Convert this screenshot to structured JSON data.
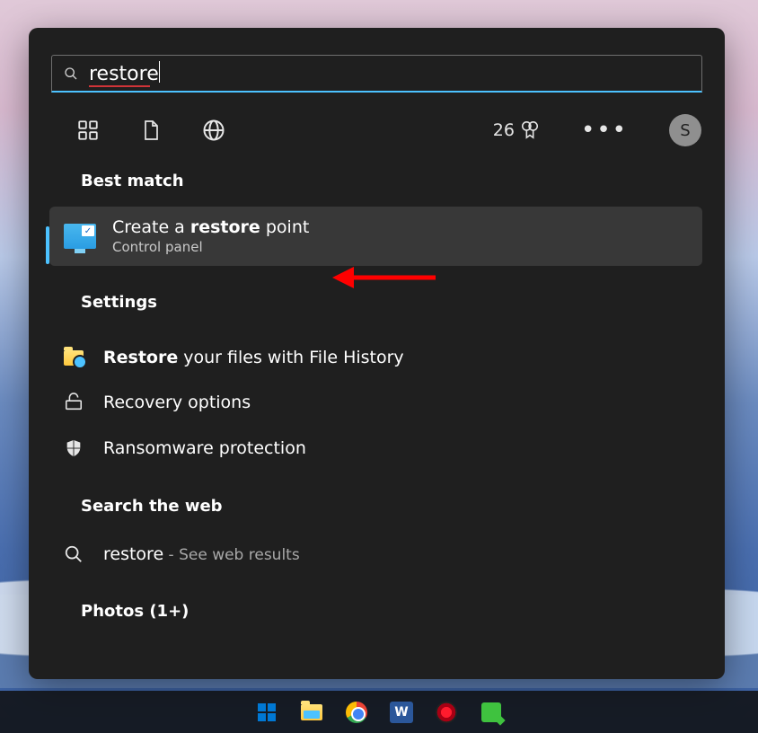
{
  "search": {
    "value": "restore"
  },
  "rewards": {
    "points": "26"
  },
  "avatar": {
    "letter": "S"
  },
  "sections": {
    "best_match": "Best match",
    "settings": "Settings",
    "search_web": "Search the web",
    "photos": "Photos (1+)"
  },
  "best": {
    "pre": "Create a ",
    "highlight": "restore",
    "post": " point",
    "sub": "Control panel"
  },
  "settings_items": {
    "fh_pre_b": "Restore",
    "fh_post": " your files with File History",
    "recovery": "Recovery options",
    "ransomware": "Ransomware protection"
  },
  "web": {
    "term": "restore",
    "suffix": " - See web results"
  },
  "word_icon_letter": "W"
}
